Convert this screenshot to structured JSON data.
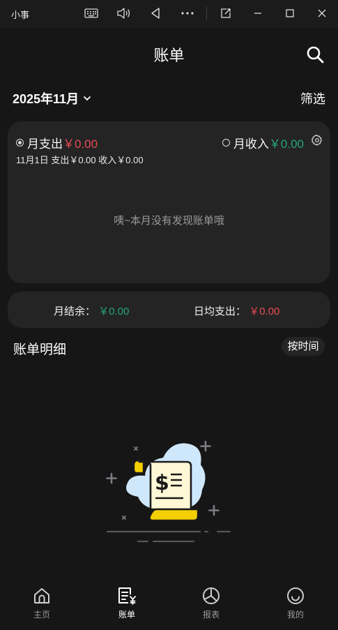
{
  "window": {
    "app_name": "小事"
  },
  "header": {
    "title": "账单"
  },
  "toolbar": {
    "month": "2025年11月",
    "filter_label": "筛选"
  },
  "summary": {
    "expense_label": "月支出",
    "expense_value": "￥0.00",
    "income_label": "月收入",
    "income_value": "￥0.00",
    "day_line": "11月1日  支出￥0.00  收入￥0.00",
    "empty_message": "咦~本月没有发现账单哦"
  },
  "balance": {
    "balance_label": "月结余：",
    "balance_value": "￥0.00",
    "daily_label": "日均支出：",
    "daily_value": "￥0.00"
  },
  "detail": {
    "title": "账单明细",
    "sort_label": "按时间"
  },
  "nav": {
    "items": [
      {
        "label": "主页",
        "icon": "home-icon"
      },
      {
        "label": "账单",
        "icon": "bill-icon"
      },
      {
        "label": "报表",
        "icon": "pie-chart-icon"
      },
      {
        "label": "我的",
        "icon": "smile-icon"
      }
    ],
    "active": "账单"
  },
  "colors": {
    "expense": "#e84a55",
    "income": "#27a57a",
    "accent_yellow": "#f5d000"
  }
}
